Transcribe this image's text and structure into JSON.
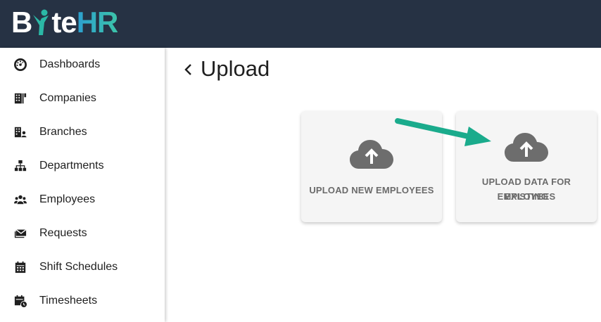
{
  "app": {
    "logo_b": "B",
    "logo_te": "te",
    "logo_hr": "HR",
    "accent": "#2bb8a6",
    "topbar_color": "#263244"
  },
  "sidebar": {
    "items": [
      {
        "label": "Dashboards",
        "icon": "dashboard-icon"
      },
      {
        "label": "Companies",
        "icon": "building-icon"
      },
      {
        "label": "Branches",
        "icon": "branch-icon"
      },
      {
        "label": "Departments",
        "icon": "hierarchy-icon"
      },
      {
        "label": "Employees",
        "icon": "people-icon"
      },
      {
        "label": "Requests",
        "icon": "mail-icon"
      },
      {
        "label": "Shift Schedules",
        "icon": "calendar-icon"
      },
      {
        "label": "Timesheets",
        "icon": "calendar-clock-icon"
      }
    ]
  },
  "main": {
    "title": "Upload",
    "cards": [
      {
        "label_line1": "UPLOAD NEW EMPLOYEES",
        "label_line2": "",
        "icon": "cloud-upload-icon"
      },
      {
        "label_line1": "UPLOAD DATA FOR EXISTING",
        "label_line2": "EMPLOYEES",
        "icon": "cloud-upload-icon"
      }
    ],
    "annotation_arrow_color": "#1aab8c"
  }
}
